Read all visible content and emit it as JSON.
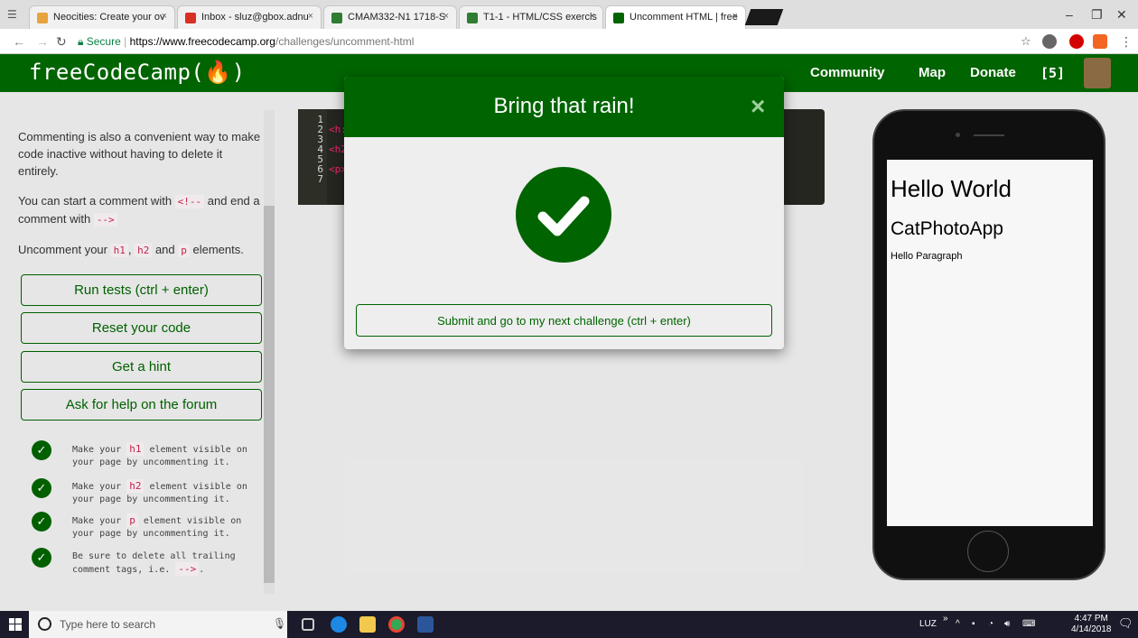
{
  "browser": {
    "tabs": [
      {
        "label": "Neocities: Create your ov",
        "favicon_color": "#e8a33d"
      },
      {
        "label": "Inbox - sluz@gbox.adnu",
        "favicon_color": "#d93025"
      },
      {
        "label": "CMAM332-N1 1718-S",
        "favicon_color": "#2e7d32"
      },
      {
        "label": "T1-1 - HTML/CSS exercis",
        "favicon_color": "#2e7d32"
      },
      {
        "label": "Uncomment HTML | free",
        "favicon_color": "#006400"
      }
    ],
    "url_secure": "Secure",
    "url_host": "https://www.freecodecamp.org",
    "url_path": "/challenges/uncomment-html"
  },
  "fcc_nav": {
    "logo": "freeCodeCamp(🔥)",
    "links": [
      "Community",
      "Map",
      "Donate"
    ],
    "points": "[5]"
  },
  "instructions": {
    "p1": "Commenting is also a convenient way to make code inactive without having to delete it entirely.",
    "p2_a": "You can start a comment with ",
    "p2_code1": "<!--",
    "p2_b": " and end a comment with ",
    "p2_code2": "-->",
    "p3_a": "Uncomment your ",
    "p3_c1": "h1",
    "p3_b": ", ",
    "p3_c2": "h2",
    "p3_c": " and ",
    "p3_c3": "p",
    "p3_d": " elements."
  },
  "buttons": {
    "run": "Run tests (ctrl + enter)",
    "reset": "Reset your code",
    "hint": "Get a hint",
    "forum": "Ask for help on the forum"
  },
  "tests": [
    {
      "a": "Make your ",
      "code": "h1",
      "b": " element visible on your page by uncommenting it."
    },
    {
      "a": "Make your ",
      "code": "h2",
      "b": " element visible on your page by uncommenting it."
    },
    {
      "a": "Make your ",
      "code": "p",
      "b": " element visible on your page by uncommenting it."
    },
    {
      "a": "Be sure to delete all trailing comment tags, i.e. ",
      "code": "-->",
      "b": "."
    }
  ],
  "editor": {
    "line_numbers": [
      "1",
      "2",
      "3",
      "4",
      "5",
      "6",
      "7"
    ],
    "lines": [
      "",
      "<h:",
      "",
      "<h2",
      "",
      "<p>",
      ""
    ]
  },
  "preview": {
    "h1": "Hello World",
    "h2": "CatPhotoApp",
    "p": "Hello Paragraph"
  },
  "modal": {
    "title": "Bring that rain!",
    "close": "×",
    "submit": "Submit and go to my next challenge (ctrl + enter)"
  },
  "taskbar": {
    "search_placeholder": "Type here to search",
    "user": "LUZ",
    "time": "4:47 PM",
    "date": "4/14/2018"
  },
  "colors": {
    "fcc_green": "#006400",
    "page_bg": "#eeeeee"
  }
}
